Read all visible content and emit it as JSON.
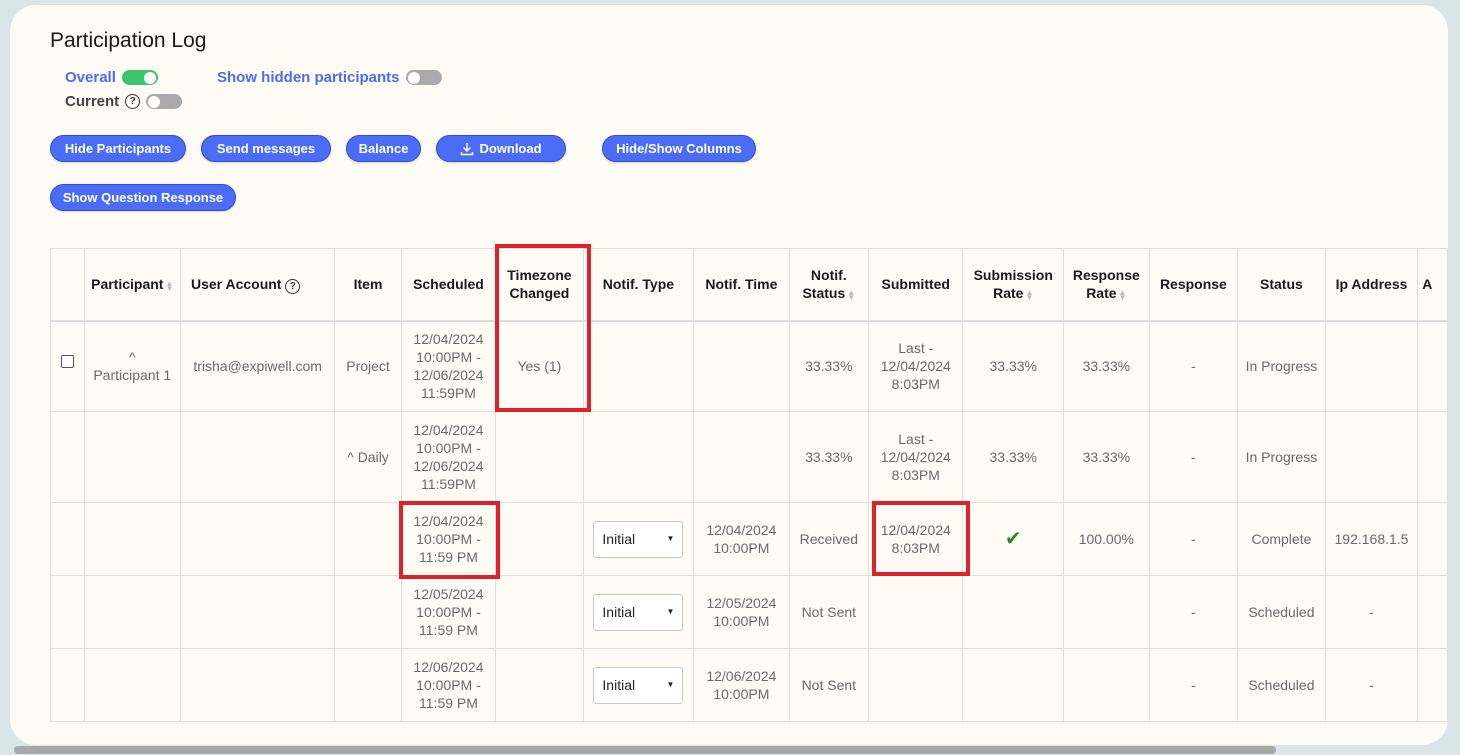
{
  "page": {
    "title": "Participation Log"
  },
  "toggles": {
    "overall": "Overall",
    "current": "Current",
    "show_hidden": "Show hidden participants",
    "help": "?"
  },
  "buttons": {
    "hide_participants": "Hide Participants",
    "send_messages": "Send messages",
    "balance": "Balance",
    "download": "Download",
    "hide_show_columns": "Hide/Show Columns",
    "show_question_response": "Show Question Response"
  },
  "table": {
    "headers": {
      "participant": "Participant",
      "user_account": "User Account",
      "item": "Item",
      "scheduled": "Scheduled",
      "timezone_changed": "Timezone Changed",
      "notif_type": "Notif. Type",
      "notif_time": "Notif. Time",
      "notif_status": "Notif. Status",
      "submitted": "Submitted",
      "submission_rate": "Submission Rate",
      "response_rate": "Response Rate",
      "response": "Response",
      "status": "Status",
      "ip_address": "Ip Address",
      "more": "A"
    },
    "rows": [
      {
        "participant": "Participant 1",
        "user_account": "trisha@expiwell.com",
        "item": "Project",
        "scheduled": "12/04/2024 10:00PM - 12/06/2024 11:59PM",
        "timezone_changed": "Yes (1)",
        "notif_status": "33.33%",
        "submitted": "Last - 12/04/2024 8:03PM",
        "submission_rate": "33.33%",
        "response_rate": "33.33%",
        "response": "-",
        "status": "In Progress"
      },
      {
        "item": "Daily",
        "scheduled": "12/04/2024 10:00PM - 12/06/2024 11:59PM",
        "notif_status": "33.33%",
        "submitted": "Last - 12/04/2024 8:03PM",
        "submission_rate": "33.33%",
        "response_rate": "33.33%",
        "response": "-",
        "status": "In Progress"
      },
      {
        "scheduled": "12/04/2024 10:00PM - 11:59 PM",
        "notif_type": "Initial",
        "notif_time": "12/04/2024 10:00PM",
        "notif_status": "Received",
        "submitted": "12/04/2024 8:03PM",
        "response_rate": "100.00%",
        "response": "-",
        "status": "Complete",
        "ip_address": "192.168.1.5"
      },
      {
        "scheduled": "12/05/2024 10:00PM - 11:59 PM",
        "notif_type": "Initial",
        "notif_time": "12/05/2024 10:00PM",
        "notif_status": "Not Sent",
        "response": "-",
        "status": "Scheduled",
        "ip_address": "-"
      },
      {
        "scheduled": "12/06/2024 10:00PM - 11:59 PM",
        "notif_type": "Initial",
        "notif_time": "12/06/2024 10:00PM",
        "notif_status": "Not Sent",
        "response": "-",
        "status": "Scheduled",
        "ip_address": "-"
      }
    ]
  },
  "colors": {
    "accent": "#4a6cf7",
    "toggle_on": "#3ec46d",
    "highlight": "#e0202a"
  }
}
